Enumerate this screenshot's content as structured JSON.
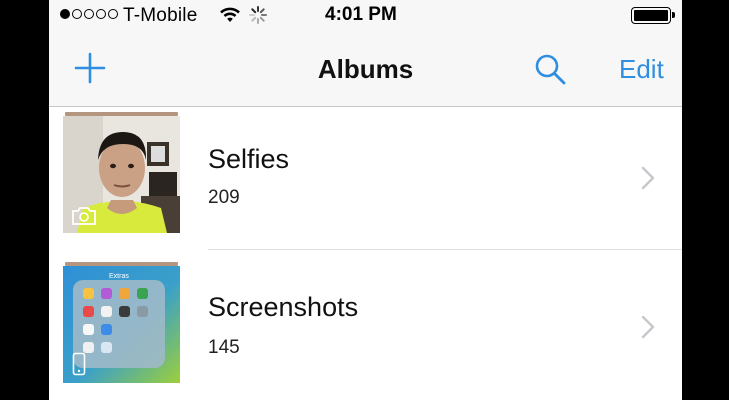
{
  "status_bar": {
    "carrier": "T-Mobile",
    "time": "4:01 PM",
    "signal_bars_filled": 1,
    "signal_bars_total": 5,
    "battery_level": 1.0
  },
  "nav": {
    "title": "Albums",
    "edit_label": "Edit",
    "add_icon": "plus-icon",
    "search_icon": "search-icon",
    "accent_color": "#2f8ee0"
  },
  "albums": [
    {
      "name": "Selfies",
      "count": "209",
      "thumbnail": "selfie-photo",
      "badge_icon": "front-camera-icon"
    },
    {
      "name": "Screenshots",
      "count": "145",
      "thumbnail": "home-screen-screenshot",
      "badge_icon": "iphone-icon",
      "folder_label": "Extras"
    }
  ]
}
